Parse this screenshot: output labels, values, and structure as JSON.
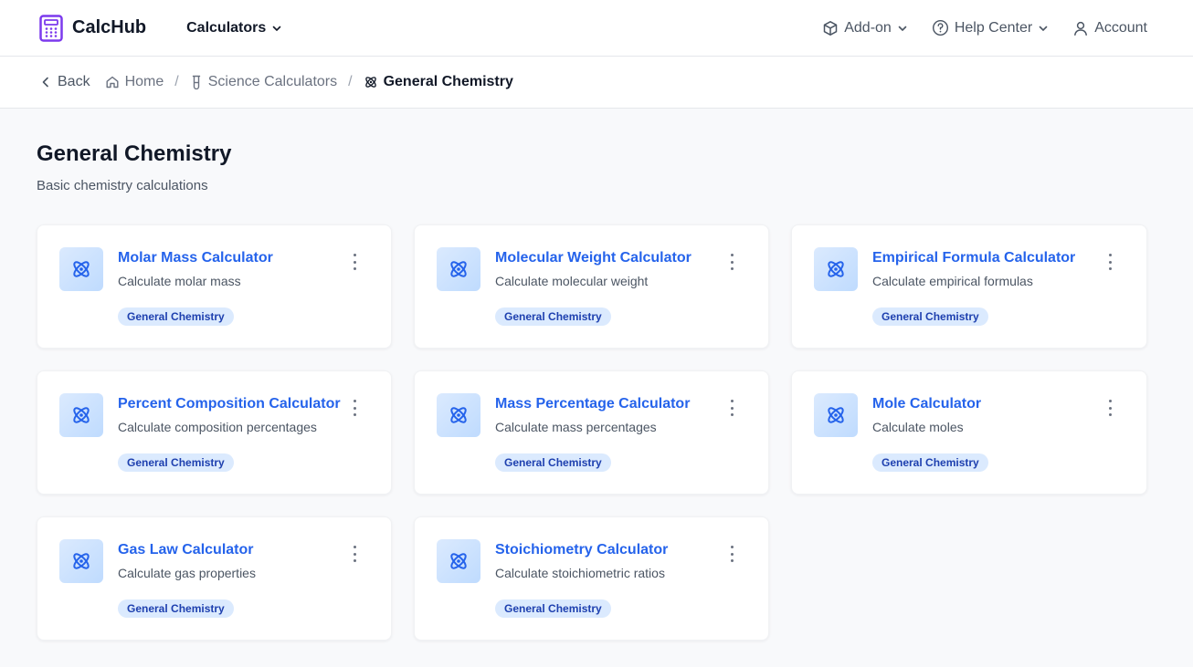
{
  "header": {
    "brand": "CalcHub",
    "calculators_label": "Calculators",
    "addon_label": "Add-on",
    "help_label": "Help Center",
    "account_label": "Account"
  },
  "breadcrumb": {
    "back": "Back",
    "home": "Home",
    "science": "Science Calculators",
    "current": "General Chemistry"
  },
  "page": {
    "title": "General Chemistry",
    "subtitle": "Basic chemistry calculations"
  },
  "cards": [
    {
      "title": "Molar Mass Calculator",
      "desc": "Calculate molar mass",
      "tag": "General Chemistry"
    },
    {
      "title": "Molecular Weight Calculator",
      "desc": "Calculate molecular weight",
      "tag": "General Chemistry"
    },
    {
      "title": "Empirical Formula Calculator",
      "desc": "Calculate empirical formulas",
      "tag": "General Chemistry"
    },
    {
      "title": "Percent Composition Calculator",
      "desc": "Calculate composition percentages",
      "tag": "General Chemistry"
    },
    {
      "title": "Mass Percentage Calculator",
      "desc": "Calculate mass percentages",
      "tag": "General Chemistry"
    },
    {
      "title": "Mole Calculator",
      "desc": "Calculate moles",
      "tag": "General Chemistry"
    },
    {
      "title": "Gas Law Calculator",
      "desc": "Calculate gas properties",
      "tag": "General Chemistry"
    },
    {
      "title": "Stoichiometry Calculator",
      "desc": "Calculate stoichiometric ratios",
      "tag": "General Chemistry"
    }
  ],
  "icons": {
    "logo": "calculator-icon",
    "card": "atom-icon",
    "menu": "more-vertical-icon"
  },
  "colors": {
    "brand": "#7c3aed",
    "link": "#2563eb",
    "tag_bg": "#dbeafe",
    "tag_text": "#1e40af"
  }
}
